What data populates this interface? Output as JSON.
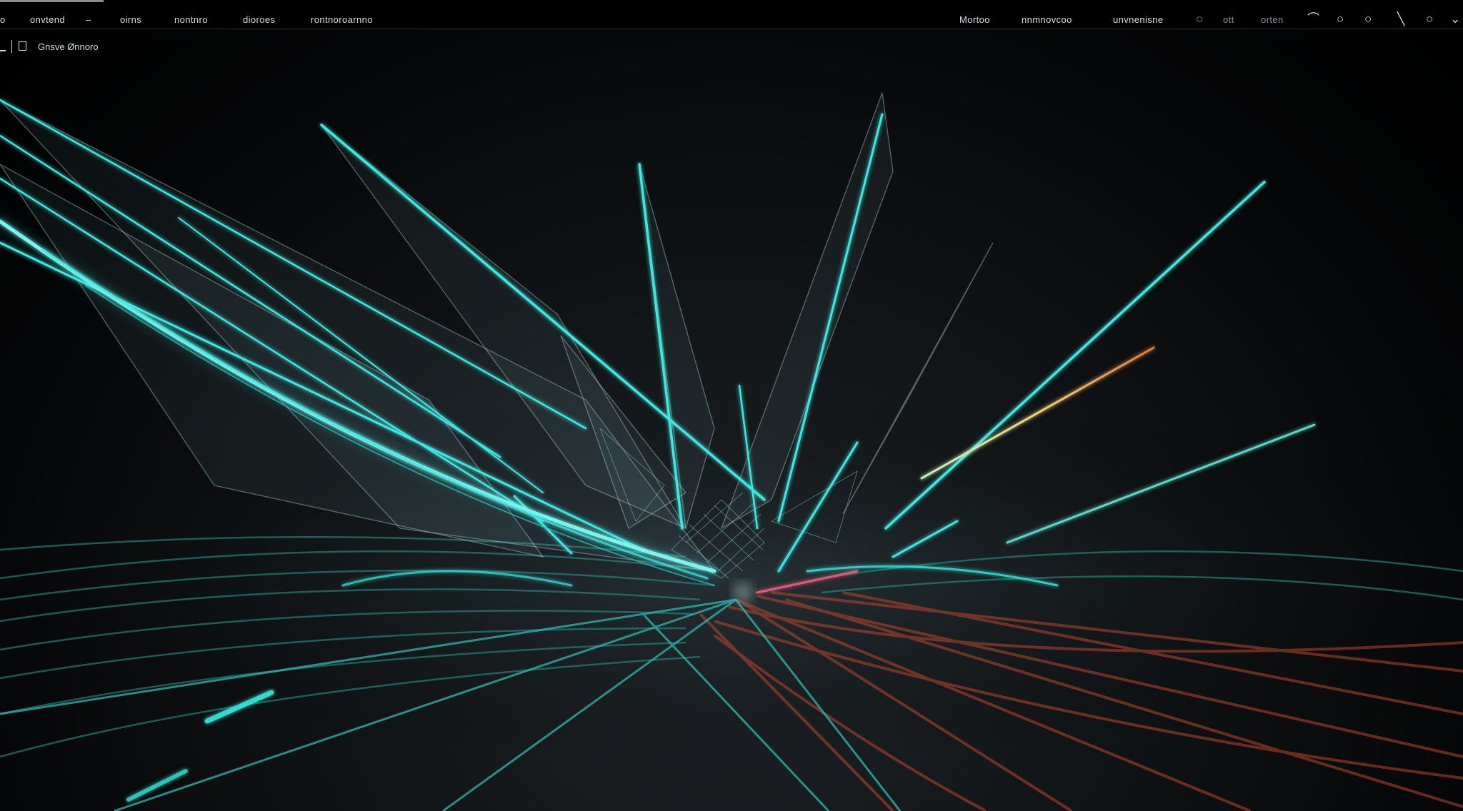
{
  "menubar": {
    "left_items": [
      "o",
      "onvtend",
      "–",
      "oirns",
      "nontnro",
      "dioroes",
      "rontnoroarnno"
    ],
    "right_items": [
      "Mortoo",
      "nnmnovcoo",
      "unvnenisne"
    ],
    "dim_items": [
      "ott",
      "orten"
    ]
  },
  "subbar": {
    "label": "Gnsve Ønnoro"
  },
  "colors": {
    "background": "#000000",
    "accent": "#33e0d6",
    "warm": "#c4553a"
  }
}
